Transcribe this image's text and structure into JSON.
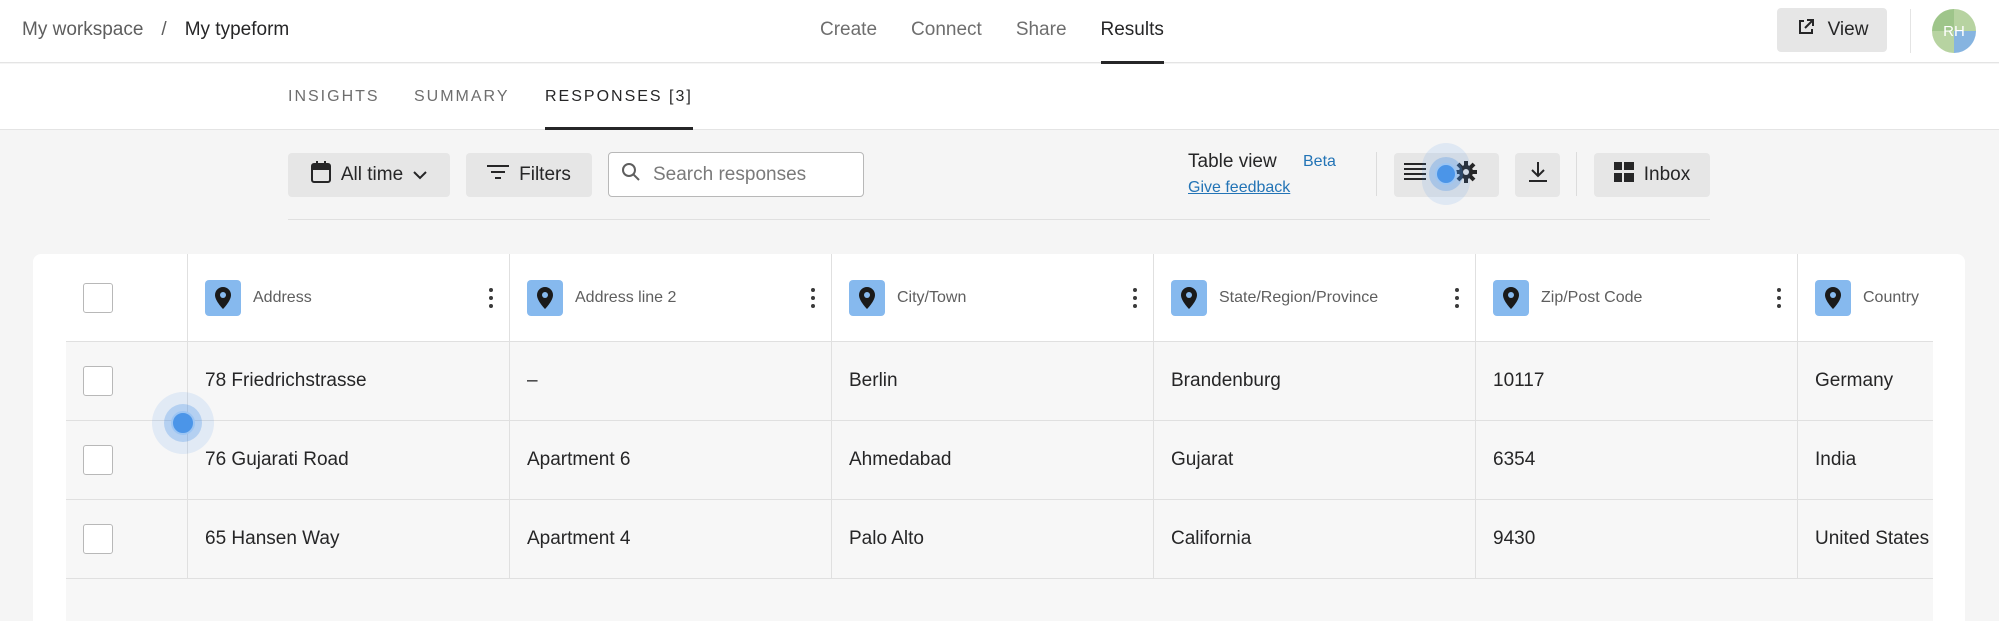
{
  "breadcrumb": {
    "workspace": "My workspace",
    "separator": "/",
    "form": "My typeform"
  },
  "topnav": {
    "items": [
      "Create",
      "Connect",
      "Share",
      "Results"
    ],
    "active": "Results"
  },
  "view_button": "View",
  "avatar_initials": "RH",
  "subtabs": {
    "items": [
      "INSIGHTS",
      "SUMMARY",
      "RESPONSES [3]"
    ],
    "active": "RESPONSES [3]"
  },
  "toolbar": {
    "date_filter": "All time",
    "filters_label": "Filters",
    "search_placeholder": "Search responses",
    "table_view_label": "Table view",
    "beta_label": "Beta",
    "feedback_link": "Give feedback",
    "inbox_label": "Inbox"
  },
  "table": {
    "columns": [
      "Address",
      "Address line 2",
      "City/Town",
      "State/Region/Province",
      "Zip/Post Code",
      "Country"
    ],
    "rows": [
      [
        "78 Friedrichstrasse",
        "–",
        "Berlin",
        "Brandenburg",
        "10117",
        "Germany"
      ],
      [
        "76 Gujarati Road",
        "Apartment 6",
        "Ahmedabad",
        "Gujarat",
        "6354",
        "India"
      ],
      [
        "65 Hansen Way",
        "Apartment 4",
        "Palo Alto",
        "California",
        "9430",
        "United States"
      ]
    ]
  },
  "colors": {
    "accent_blue": "#2374b6",
    "column_icon_bg": "#86b9ee",
    "button_bg": "#e6e6e6"
  }
}
